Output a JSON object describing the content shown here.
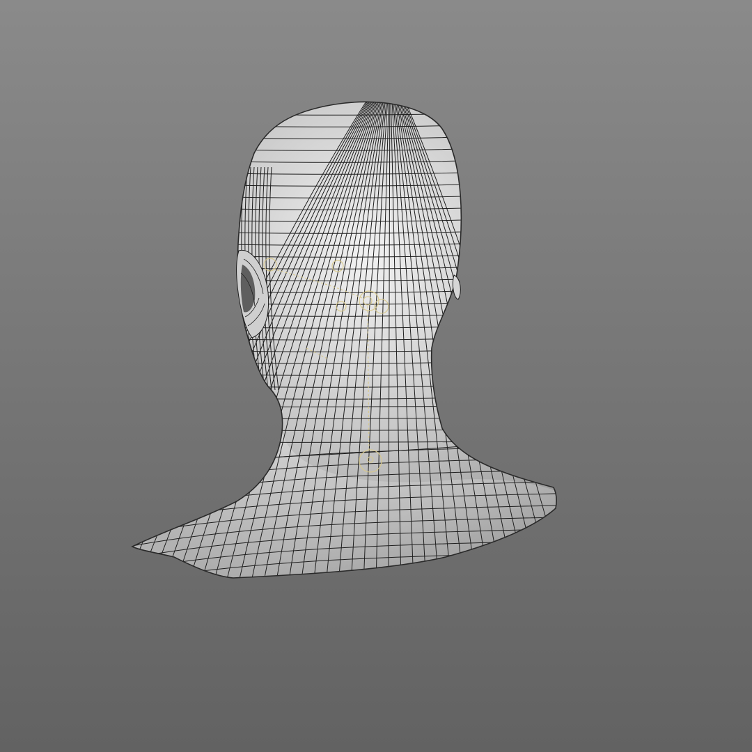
{
  "viewport": {
    "background_top": "#8a8a8a",
    "background_bottom": "#626262"
  },
  "model": {
    "mesh_fill_light": "#f2f2f2",
    "mesh_fill_mid": "#c4c4c4",
    "mesh_fill_dark": "#8c8c8c",
    "wire_color": "#1e1e1e",
    "joint_color": "#d9c98a"
  }
}
